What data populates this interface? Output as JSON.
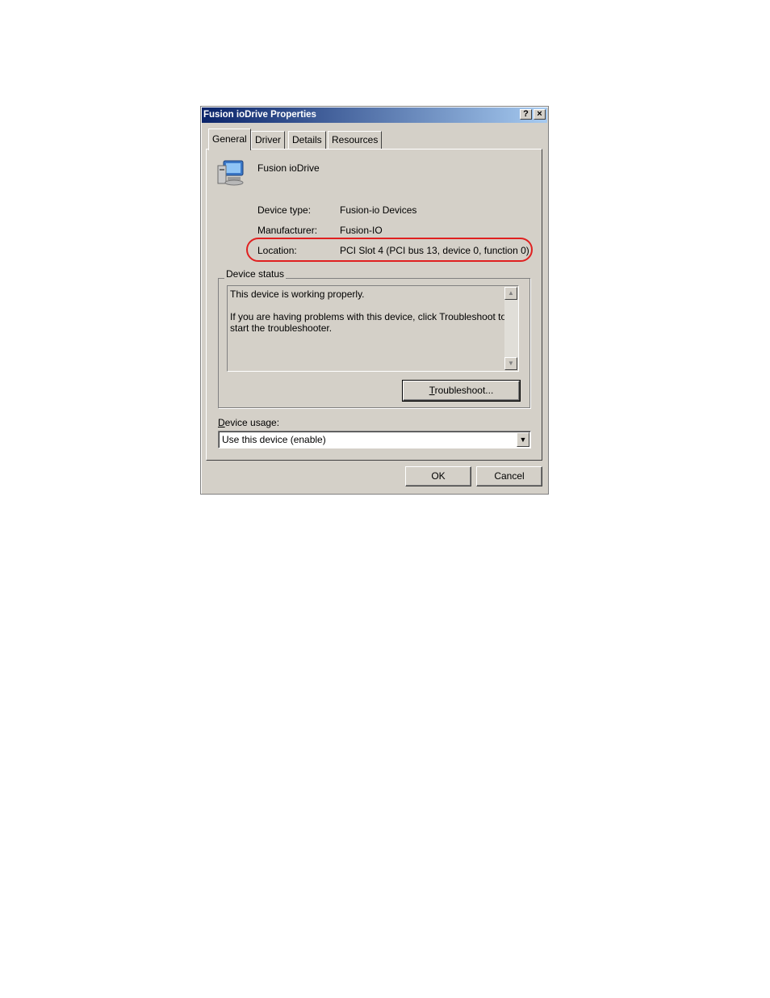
{
  "window": {
    "title": "Fusion ioDrive Properties",
    "help_button": "?",
    "close_button": "×"
  },
  "tabs": [
    {
      "label": "General",
      "active": true
    },
    {
      "label": "Driver"
    },
    {
      "label": "Details"
    },
    {
      "label": "Resources"
    }
  ],
  "device": {
    "icon": "computer-device-icon",
    "name": "Fusion ioDrive",
    "device_type_label": "Device type:",
    "device_type_value": "Fusion-io Devices",
    "manufacturer_label": "Manufacturer:",
    "manufacturer_value": "Fusion-IO",
    "location_label": "Location:",
    "location_value": "PCI Slot 4 (PCI bus 13, device 0, function 0)"
  },
  "device_status": {
    "legend": "Device status",
    "line1": "This device is working properly.",
    "line2": "If you are having problems with this device, click Troubleshoot to",
    "line3": "start the troubleshooter.",
    "troubleshoot_mnemonic": "T",
    "troubleshoot_rest": "roubleshoot..."
  },
  "device_usage": {
    "label_mnemonic": "D",
    "label_rest": "evice usage:",
    "selected": "Use this device (enable)"
  },
  "footer": {
    "ok": "OK",
    "cancel": "Cancel"
  },
  "colors": {
    "highlight_oval": "#e02020",
    "titlebar_start": "#0a246a",
    "titlebar_end": "#a6caf0",
    "dialog_bg": "#d4d0c8"
  }
}
